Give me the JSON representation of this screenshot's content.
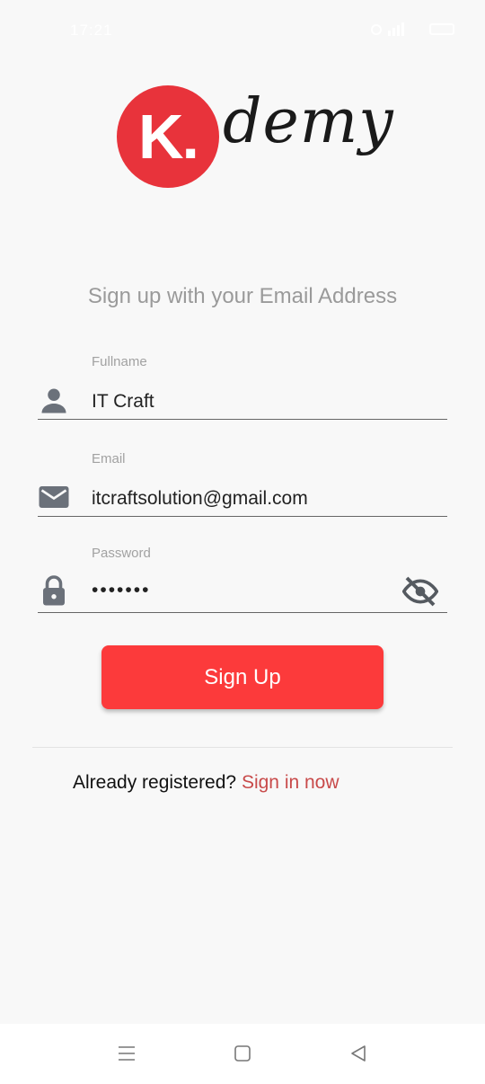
{
  "status_bar": {
    "time": "17:21"
  },
  "logo": {
    "letter": "K.",
    "word": "demy"
  },
  "headline": "Sign up with your Email Address",
  "form": {
    "fullname": {
      "label": "Fullname",
      "value": "IT Craft"
    },
    "email": {
      "label": "Email",
      "value": "itcraftsolution@gmail.com"
    },
    "password": {
      "label": "Password",
      "value": "•••••••"
    }
  },
  "signup_button": "Sign Up",
  "signin": {
    "prompt": "Already registered?",
    "link": "Sign in now"
  },
  "colors": {
    "accent": "#fc3a3b",
    "link": "#c84a4a",
    "logo_red": "#e8333b",
    "icon_gray": "#6b717a"
  },
  "icons": {
    "status": [
      "alarm-icon",
      "signal-icon",
      "battery-icon"
    ],
    "fields": [
      "person-icon",
      "mail-icon",
      "lock-icon",
      "eye-off-icon"
    ],
    "nav": [
      "menu-icon",
      "home-square-icon",
      "back-triangle-icon"
    ]
  }
}
